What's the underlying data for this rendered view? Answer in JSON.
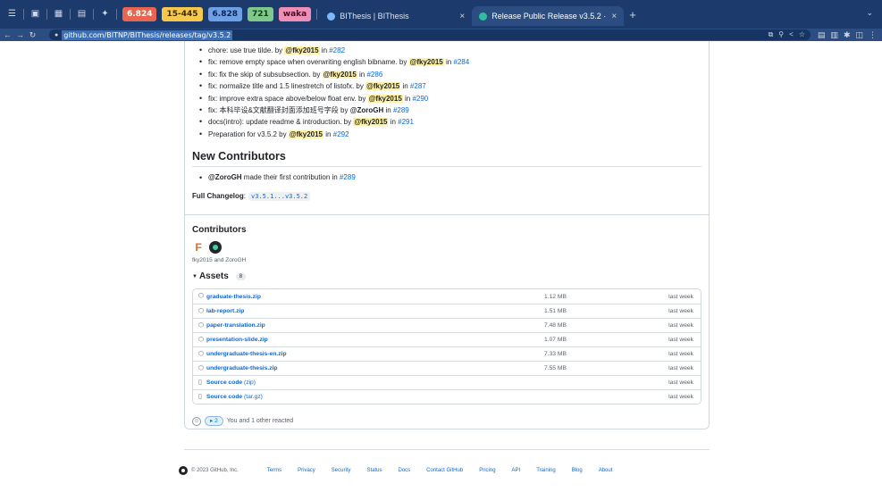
{
  "browser": {
    "badges": [
      "6.824",
      "15-445",
      "6.828",
      "721",
      "waka"
    ],
    "tabs": [
      {
        "title": "BIThesis | BIThesis"
      },
      {
        "title": "Release Public Release v3.5.2 · BITNP/BIThesis"
      }
    ],
    "url": "github.com/BITNP/BIThesis/releases/tag/v3.5.2"
  },
  "notes": [
    {
      "text": "chore: use true tilde. by ",
      "user": "@fky2015",
      "in": " in ",
      "pr": "#282"
    },
    {
      "text": "fix: remove empty space when overwriting english bibname. by ",
      "user": "@fky2015",
      "in": " in ",
      "pr": "#284"
    },
    {
      "text": "fix: fix the skip of subsubsection. by ",
      "user": "@fky2015",
      "in": " in ",
      "pr": "#286"
    },
    {
      "text": "fix: normalize title and 1.5 linestretch of listofx. by ",
      "user": "@fky2015",
      "in": " in ",
      "pr": "#287"
    },
    {
      "text": "fix: improve extra space above/below float env. by ",
      "user": "@fky2015",
      "in": " in ",
      "pr": "#290"
    },
    {
      "text": "fix: 本科毕设&文献翻译封面添加班号字段 by ",
      "user": "@ZoroGH",
      "in": " in ",
      "pr": "#289"
    },
    {
      "text": "docs(intro): update readme & introduction. by ",
      "user": "@fky2015",
      "in": " in ",
      "pr": "#291"
    },
    {
      "text": "Preparation for v3.5.2 by ",
      "user": "@fky2015",
      "in": " in ",
      "pr": "#292"
    }
  ],
  "new_contributors": {
    "title": "New Contributors",
    "user": "@ZoroGH",
    "text": " made their first contribution in ",
    "pr": "#289"
  },
  "changelog": {
    "label": "Full Changelog",
    "colon": ":",
    "range": "v3.5.1...v3.5.2"
  },
  "contributors": {
    "title": "Contributors",
    "avatar_letter": "F",
    "names": "fky2015 and ZoroGH"
  },
  "assets": {
    "label": "Assets",
    "count": "8",
    "items": [
      {
        "name": "graduate-thesis.zip",
        "size": "1.12 MB",
        "when": "last week"
      },
      {
        "name": "lab-report.zip",
        "size": "1.51 MB",
        "when": "last week"
      },
      {
        "name": "paper-translation.zip",
        "size": "7.48 MB",
        "when": "last week"
      },
      {
        "name": "presentation-slide.zip",
        "size": "1.07 MB",
        "when": "last week"
      },
      {
        "name": "undergraduate-thesis-en.zip",
        "size": "7.33 MB",
        "when": "last week"
      },
      {
        "name": "undergraduate-thesis.zip",
        "size": "7.55 MB",
        "when": "last week"
      }
    ],
    "sources": [
      {
        "name": "Source code",
        "fmt": "(zip)",
        "when": "last week"
      },
      {
        "name": "Source code",
        "fmt": "(tar.gz)",
        "when": "last week"
      }
    ]
  },
  "reactions": {
    "count": "2",
    "text": "You and 1 other reacted"
  },
  "footer": {
    "copyright": "© 2023 GitHub, Inc.",
    "links": [
      "Terms",
      "Privacy",
      "Security",
      "Status",
      "Docs",
      "Contact GitHub",
      "Pricing",
      "API",
      "Training",
      "Blog",
      "About"
    ]
  },
  "colors": {
    "link": "#0969da",
    "mention_highlight": "#fff1a6",
    "chrome": "#1c3a6b"
  }
}
